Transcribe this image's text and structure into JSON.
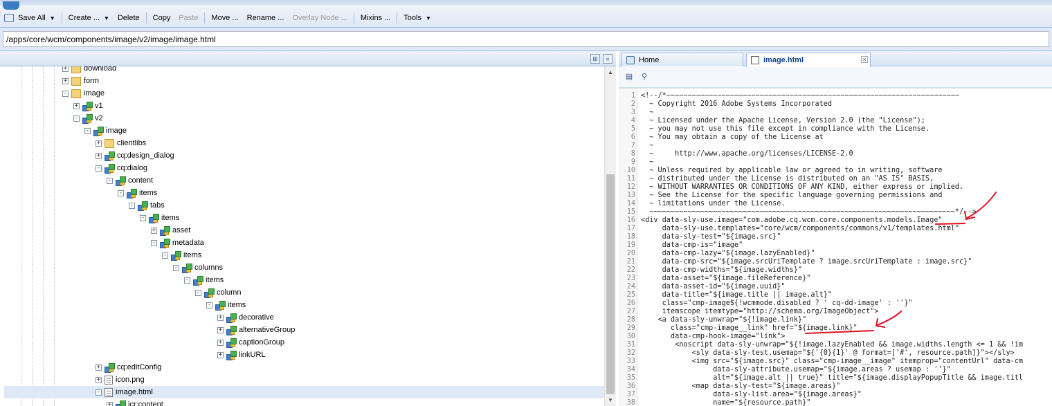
{
  "toolbar": {
    "buttons": [
      {
        "label": "Save All",
        "dropdown": true,
        "disabled": false
      },
      {
        "label": "Create ...",
        "dropdown": true,
        "disabled": false
      },
      {
        "label": "Delete",
        "dropdown": false,
        "disabled": false
      },
      {
        "label": "Copy",
        "dropdown": false,
        "disabled": false
      },
      {
        "label": "Paste",
        "dropdown": false,
        "disabled": true
      },
      {
        "label": "Move ...",
        "dropdown": false,
        "disabled": false
      },
      {
        "label": "Rename ...",
        "dropdown": false,
        "disabled": false
      },
      {
        "label": "Overlay Node ...",
        "dropdown": false,
        "disabled": true
      },
      {
        "label": "Mixins ...",
        "dropdown": false,
        "disabled": false
      },
      {
        "label": "Tools",
        "dropdown": true,
        "disabled": false
      }
    ]
  },
  "path": {
    "value": "/apps/core/wcm/components/image/v2/image/image.html"
  },
  "tree": {
    "items": [
      {
        "label": "download",
        "icon": "folder-icon",
        "depth": 0,
        "expanded": false,
        "expander": "+"
      },
      {
        "label": "form",
        "icon": "folder-icon",
        "depth": 0,
        "expanded": false,
        "expander": "+"
      },
      {
        "label": "image",
        "icon": "folder-icon",
        "depth": 0,
        "expanded": true,
        "expander": "-"
      },
      {
        "label": "v1",
        "icon": "node-icon",
        "depth": 1,
        "expanded": false,
        "expander": "+"
      },
      {
        "label": "v2",
        "icon": "node-icon",
        "depth": 1,
        "expanded": true,
        "expander": "-"
      },
      {
        "label": "image",
        "icon": "node-icon",
        "depth": 2,
        "expanded": true,
        "expander": "-"
      },
      {
        "label": "clientlibs",
        "icon": "folder-icon",
        "depth": 3,
        "expanded": false,
        "expander": "+"
      },
      {
        "label": "cq:design_dialog",
        "icon": "node-icon",
        "depth": 3,
        "expanded": false,
        "expander": "+"
      },
      {
        "label": "cq:dialog",
        "icon": "node-icon",
        "depth": 3,
        "expanded": true,
        "expander": "-"
      },
      {
        "label": "content",
        "icon": "node-icon",
        "depth": 4,
        "expanded": true,
        "expander": "-"
      },
      {
        "label": "items",
        "icon": "node-icon",
        "depth": 5,
        "expanded": true,
        "expander": "-"
      },
      {
        "label": "tabs",
        "icon": "node-icon",
        "depth": 6,
        "expanded": true,
        "expander": "-"
      },
      {
        "label": "items",
        "icon": "node-icon",
        "depth": 7,
        "expanded": true,
        "expander": "-"
      },
      {
        "label": "asset",
        "icon": "node-icon",
        "depth": 8,
        "expanded": false,
        "expander": "+"
      },
      {
        "label": "metadata",
        "icon": "node-icon",
        "depth": 8,
        "expanded": true,
        "expander": "-"
      },
      {
        "label": "items",
        "icon": "node-icon",
        "depth": 9,
        "expanded": true,
        "expander": "-"
      },
      {
        "label": "columns",
        "icon": "node-icon",
        "depth": 10,
        "expanded": true,
        "expander": "-"
      },
      {
        "label": "items",
        "icon": "node-icon",
        "depth": 11,
        "expanded": true,
        "expander": "-"
      },
      {
        "label": "column",
        "icon": "node-icon",
        "depth": 12,
        "expanded": true,
        "expander": "-"
      },
      {
        "label": "items",
        "icon": "node-icon",
        "depth": 13,
        "expanded": true,
        "expander": "-"
      },
      {
        "label": "decorative",
        "icon": "node-icon",
        "depth": 14,
        "expanded": false,
        "expander": "+"
      },
      {
        "label": "alternativeGroup",
        "icon": "node-icon",
        "depth": 14,
        "expanded": false,
        "expander": "+"
      },
      {
        "label": "captionGroup",
        "icon": "node-icon",
        "depth": 14,
        "expanded": false,
        "expander": "+"
      },
      {
        "label": "linkURL",
        "icon": "node-icon",
        "depth": 14,
        "expanded": false,
        "expander": "+"
      },
      {
        "label": "cq:editConfig",
        "icon": "node-icon",
        "depth": 3,
        "expanded": false,
        "expander": "+"
      },
      {
        "label": "icon.png",
        "icon": "file-icon",
        "depth": 3,
        "expanded": false,
        "expander": "+"
      },
      {
        "label": "image.html",
        "icon": "file-icon",
        "depth": 3,
        "expanded": true,
        "expander": "-",
        "selected": true
      },
      {
        "label": "jcr:content",
        "icon": "node-icon",
        "depth": 4,
        "expanded": false,
        "expander": "+"
      }
    ]
  },
  "tabs": [
    {
      "label": "Home",
      "icon": "home-icon",
      "active": false
    },
    {
      "label": "image.html",
      "icon": "document-icon",
      "active": true
    }
  ],
  "code": {
    "lines": [
      "<!--/*~~~~~~~~~~~~~~~~~~~~~~~~~~~~~~~~~~~~~~~~~~~~~~~~~~~~~~~~~~~~~~~~~~~~~",
      "  ~ Copyright 2016 Adobe Systems Incorporated",
      "  ~",
      "  ~ Licensed under the Apache License, Version 2.0 (the \"License\");",
      "  ~ you may not use this file except in compliance with the License.",
      "  ~ You may obtain a copy of the License at",
      "  ~",
      "  ~     http://www.apache.org/licenses/LICENSE-2.0",
      "  ~",
      "  ~ Unless required by applicable law or agreed to in writing, software",
      "  ~ distributed under the License is distributed on an \"AS IS\" BASIS,",
      "  ~ WITHOUT WARRANTIES OR CONDITIONS OF ANY KIND, either express or implied.",
      "  ~ See the License for the specific language governing permissions and",
      "  ~ limitations under the License.",
      "  ~~~~~~~~~~~~~~~~~~~~~~~~~~~~~~~~~~~~~~~~~~~~~~~~~~~~~~~~~~~~~~~~~~~~~~~~*/-->",
      "<div data-sly-use.image=\"com.adobe.cq.wcm.core.components.models.Image\"",
      "     data-sly-use.templates=\"core/wcm/components/commons/v1/templates.html\"",
      "     data-sly-test=\"${image.src}\"",
      "     data-cmp-is=\"image\"",
      "     data-cmp-lazy=\"${image.lazyEnabled}\"",
      "     data-cmp-src=\"${image.srcUriTemplate ? image.srcUriTemplate : image.src}\"",
      "     data-cmp-widths=\"${image.widths}\"",
      "     data-asset=\"${image.fileReference}\"",
      "     data-asset-id=\"${image.uuid}\"",
      "     data-title=\"${image.title || image.alt}\"",
      "     class=\"cmp-image${!wcmmode.disabled ? ' cq-dd-image' : ''}\"",
      "     itemscope itemtype=\"http://schema.org/ImageObject\">",
      "    <a data-sly-unwrap=\"${!image.link}\"",
      "       class=\"cmp-image__link\" href=\"${image.link}\"",
      "       data-cmp-hook-image=\"link\">",
      "        <noscript data-sly-unwrap=\"${!image.lazyEnabled && image.widths.length <= 1 && !im",
      "            <sly data-sly-test.usemap=\"${'{0}{1}' @ format=['#', resource.path]}\"></sly>",
      "            <img src=\"${image.src}\" class=\"cmp-image__image\" itemprop=\"contentUrl\" data-cm",
      "                 data-sly-attribute.usemap=\"${image.areas ? usemap : ''}\"",
      "                 alt=\"${image.alt || true}\" title=\"${image.displayPopupTitle && image.titl",
      "            <map data-sly-test=\"${image.areas}\"",
      "                 data-sly-list.area=\"${image.areas}\"",
      "                 name=\"${resource.path}\""
    ]
  },
  "annotations": {
    "color": "#e01020",
    "items": [
      "arrow-to-Image-model",
      "underline-image-link",
      "arrow-to-image-link"
    ]
  },
  "colors": {
    "accent": "#15428b",
    "panel_border": "#99bbe8",
    "selected_row": "#dfe8f6"
  }
}
